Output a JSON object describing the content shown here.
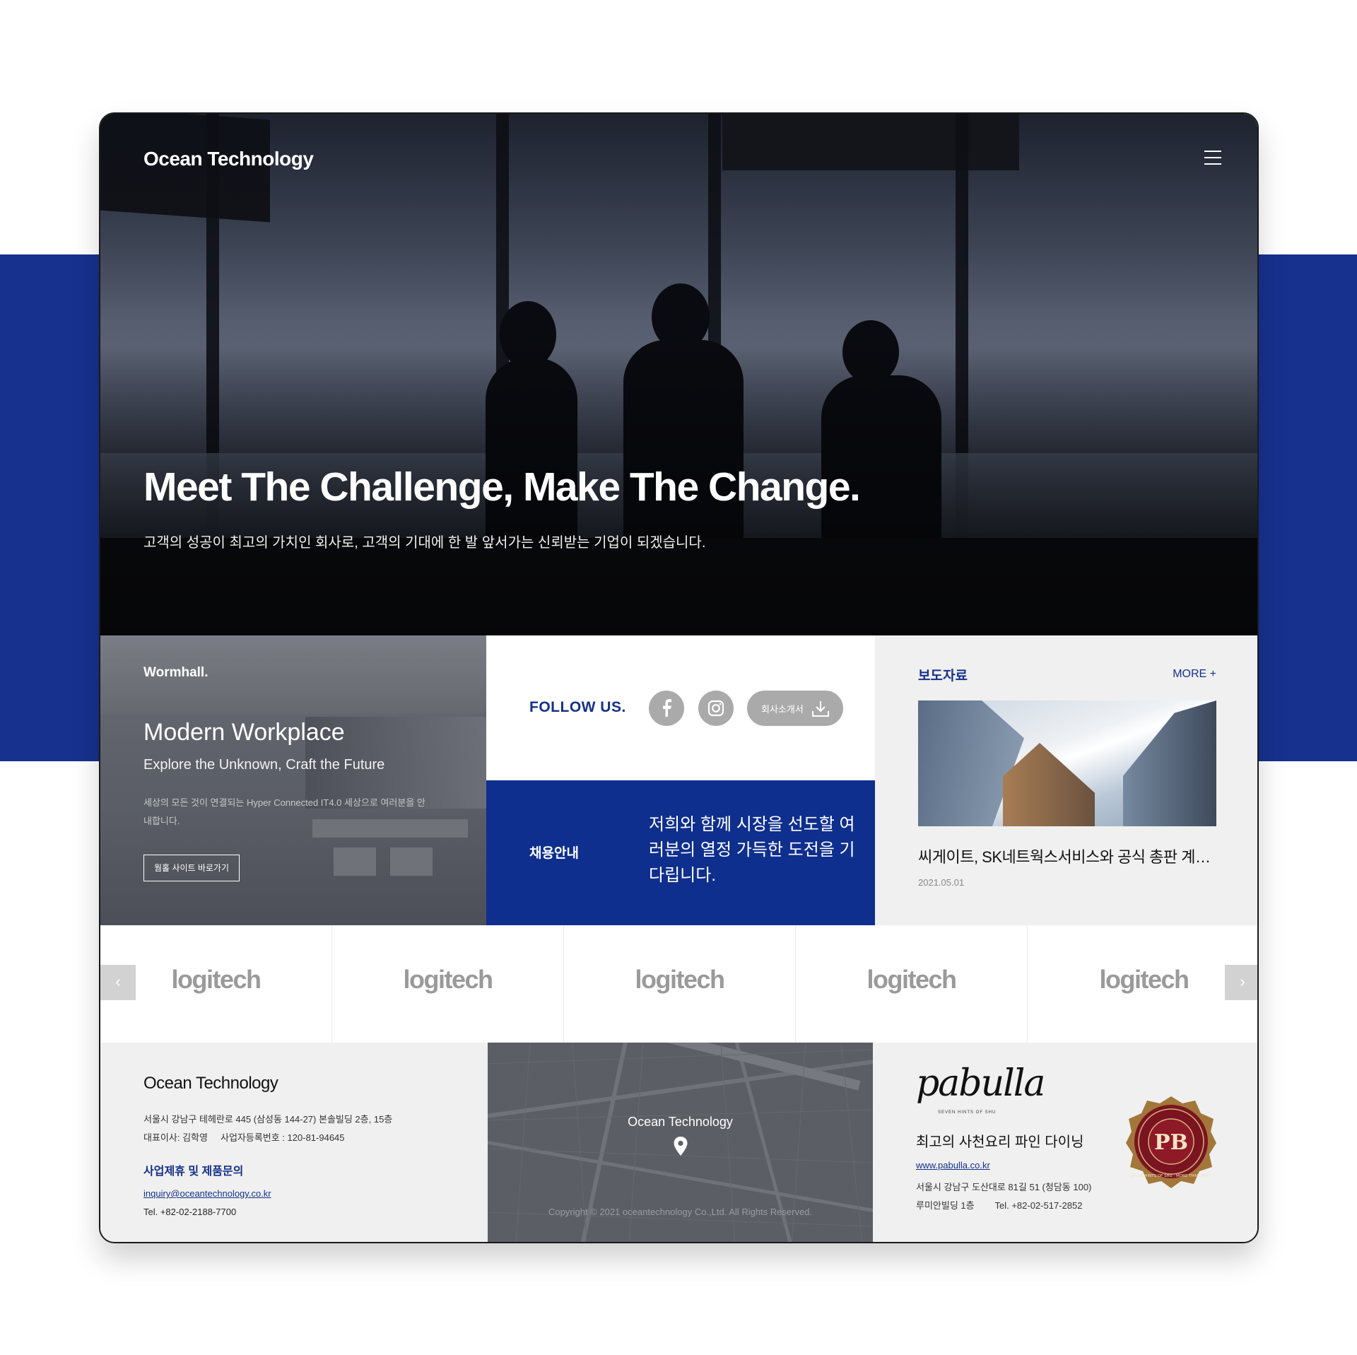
{
  "header": {
    "logo": "Ocean Technology",
    "menu_icon": "hamburger-menu-icon"
  },
  "hero": {
    "title": "Meet The Challenge, Make The Change.",
    "subtitle": "고객의 성공이 최고의 가치인 회사로, 고객의 기대에 한 발 앞서가는 신뢰받는 기업이 되겠습니다."
  },
  "wormhall": {
    "label": "Wormhall.",
    "title": "Modern Workplace",
    "subtitle": "Explore the Unknown, Craft the Future",
    "desc": "세상의 모든 것이 연결되는 Hyper Connected IT4.0 세상으로 여러분을 안내합니다.",
    "button": "웜홀 사이트 바로가기"
  },
  "follow": {
    "label": "FOLLOW US.",
    "facebook_icon": "facebook-icon",
    "instagram_icon": "instagram-icon",
    "brochure_label": "회사소개서",
    "download_icon": "download-icon"
  },
  "recruit": {
    "label": "채용안내",
    "text": "저희와 함께 시장을 선도할 여러분의 열정 가득한 도전을 기다립니다."
  },
  "press": {
    "title": "보도자료",
    "more": "MORE +",
    "headline": "씨게이트, SK네트웍스서비스와 공식 총판 계약 체결",
    "date": "2021.05.01"
  },
  "partners": {
    "logos": [
      "logitech",
      "logitech",
      "logitech",
      "logitech",
      "logitech"
    ],
    "prev": "‹",
    "next": "›"
  },
  "footer": {
    "company": "Ocean Technology",
    "address": "서울시 강남구 테헤란로 445 (삼성동 144-27) 본솔빌딩 2층, 15층",
    "ceo": "대표이사: 김학영     사업자등록번호 : 120-81-94645",
    "inquiry_title": "사업제휴 및 제품문의",
    "email": "inquiry@oceantechnology.co.kr",
    "tel": "Tel. +82-02-2188-7700",
    "map_name": "Ocean Technology",
    "copyright": "Copyright © 2021 oceantechnology  Co.,Ltd. All Rights Reserved."
  },
  "pabulla": {
    "brand": "pabulla",
    "tagline": "SEVEN HINTS OF SHU",
    "slogan": "최고의 사천요리 파인 다이닝",
    "url": "www.pabulla.co.kr",
    "address": "서울시 강남구 도산대로 81길 51 (청담동 100)",
    "building_tel": "루미안빌딩 1층        Tel. +82-02-517-2852",
    "badge_initials": "PB",
    "badge_ring": "SEVEN HINTS OF SHU · MORE THAN SPICY"
  },
  "colors": {
    "brand_blue": "#17318f",
    "accent_blue": "#14308a",
    "light_gray": "#f0f0f0"
  }
}
